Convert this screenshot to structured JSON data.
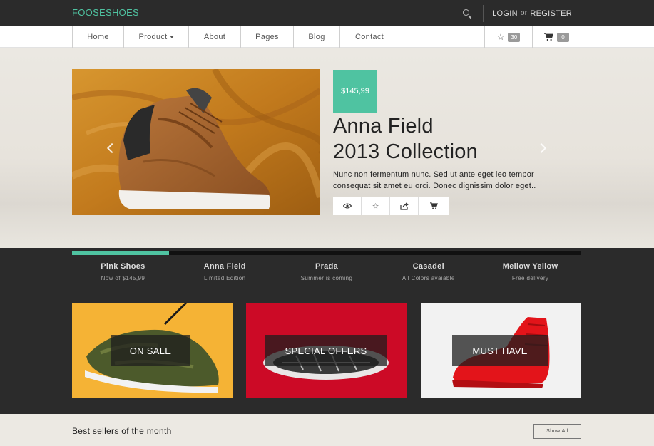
{
  "brand": "FOOSESHOES",
  "topbar": {
    "search_icon": "search-icon",
    "login": "LOGIN",
    "or": "or",
    "register": "REGISTER"
  },
  "nav": {
    "items": [
      {
        "label": "Home"
      },
      {
        "label": "Product",
        "has_dropdown": true
      },
      {
        "label": "About"
      },
      {
        "label": "Pages"
      },
      {
        "label": "Blog"
      },
      {
        "label": "Contact"
      }
    ],
    "wishlist_count": "30",
    "cart_count": "0"
  },
  "hero": {
    "price": "$145,99",
    "title_line1": "Anna Field",
    "title_line2": "2013 Collection",
    "description": "Nunc non fermentum nunc. Sed ut ante eget leo tempor consequat sit amet eu orci. Donec dignissim dolor eget..",
    "actions": [
      "eye-icon",
      "star-icon",
      "share-icon",
      "cart-icon"
    ]
  },
  "tabs": {
    "progress": 0.19,
    "items": [
      {
        "title": "Pink Shoes",
        "subtitle": "Now of $145,99"
      },
      {
        "title": "Anna Field",
        "subtitle": "Limited Edition"
      },
      {
        "title": "Prada",
        "subtitle": "Summer is coming"
      },
      {
        "title": "Casadei",
        "subtitle": "All Colors avaiable"
      },
      {
        "title": "Mellow Yellow",
        "subtitle": "Free delivery"
      }
    ]
  },
  "promos": [
    {
      "label": "ON SALE",
      "bg": "#f5b335"
    },
    {
      "label": "SPECIAL OFFERS",
      "bg": "#cc0a26"
    },
    {
      "label": "MUST HAVE",
      "bg": "#f2f2f2"
    }
  ],
  "best_sellers": {
    "title": "Best sellers of the month",
    "show_all": "Show All"
  },
  "colors": {
    "accent": "#4fc3a1",
    "dark": "#2b2b2b"
  }
}
